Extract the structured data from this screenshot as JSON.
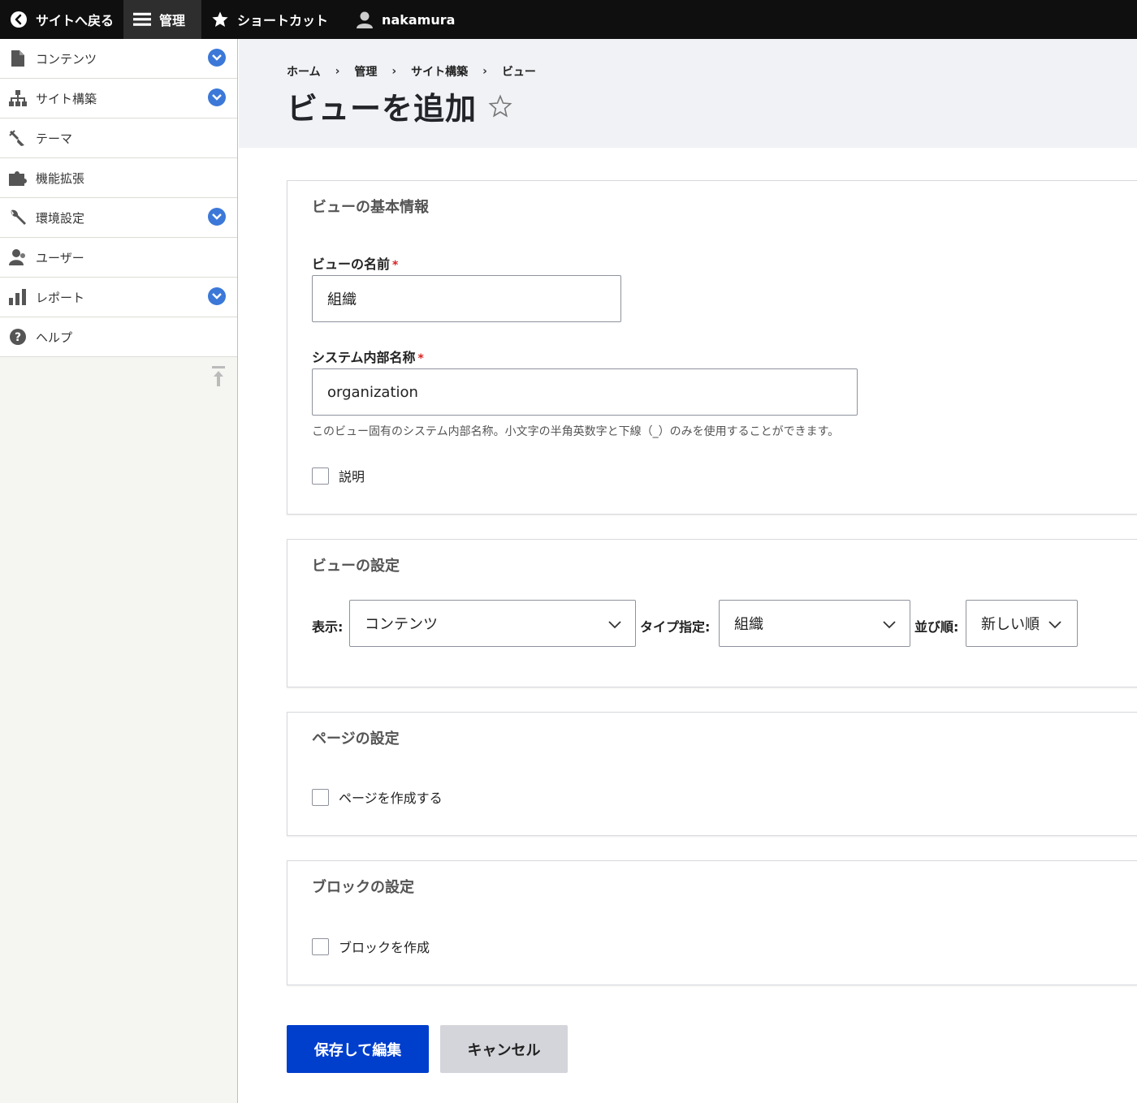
{
  "toolbar": {
    "back_label": "サイトへ戻る",
    "manage_label": "管理",
    "shortcuts_label": "ショートカット",
    "user_label": "nakamura"
  },
  "sidebar": {
    "items": [
      {
        "label": "コンテンツ",
        "icon": "file-icon",
        "expandable": true
      },
      {
        "label": "サイト構築",
        "icon": "sitemap-icon",
        "expandable": true
      },
      {
        "label": "テーマ",
        "icon": "brush-icon",
        "expandable": false
      },
      {
        "label": "機能拡張",
        "icon": "puzzle-icon",
        "expandable": false
      },
      {
        "label": "環境設定",
        "icon": "wrench-icon",
        "expandable": true
      },
      {
        "label": "ユーザー",
        "icon": "people-icon",
        "expandable": false
      },
      {
        "label": "レポート",
        "icon": "bar-chart-icon",
        "expandable": true
      },
      {
        "label": "ヘルプ",
        "icon": "help-icon",
        "expandable": false
      }
    ]
  },
  "breadcrumb": [
    "ホーム",
    "管理",
    "サイト構築",
    "ビュー"
  ],
  "page_title": "ビューを追加",
  "basic": {
    "title": "ビューの基本情報",
    "name_label": "ビューの名前",
    "name_value": "組織",
    "machine_label": "システム内部名称",
    "machine_value": "organization",
    "machine_help": "このビュー固有のシステム内部名称。小文字の半角英数字と下線（_）のみを使用することができます。",
    "description_label": "説明",
    "required_mark": "*"
  },
  "settings": {
    "title": "ビューの設定",
    "show_label": "表示:",
    "show_value": "コンテンツ",
    "type_label": "タイプ指定:",
    "type_value": "組織",
    "sort_label": "並び順:",
    "sort_value": "新しい順"
  },
  "page_settings": {
    "title": "ページの設定",
    "create_label": "ページを作成する"
  },
  "block_settings": {
    "title": "ブロックの設定",
    "create_label": "ブロックを作成"
  },
  "actions": {
    "save_label": "保存して編集",
    "cancel_label": "キャンセル"
  },
  "colors": {
    "primary": "#003ecc",
    "toolbar_bg": "#0f0f0f",
    "chevron_blue": "#3b78d8",
    "required": "#d72222"
  }
}
